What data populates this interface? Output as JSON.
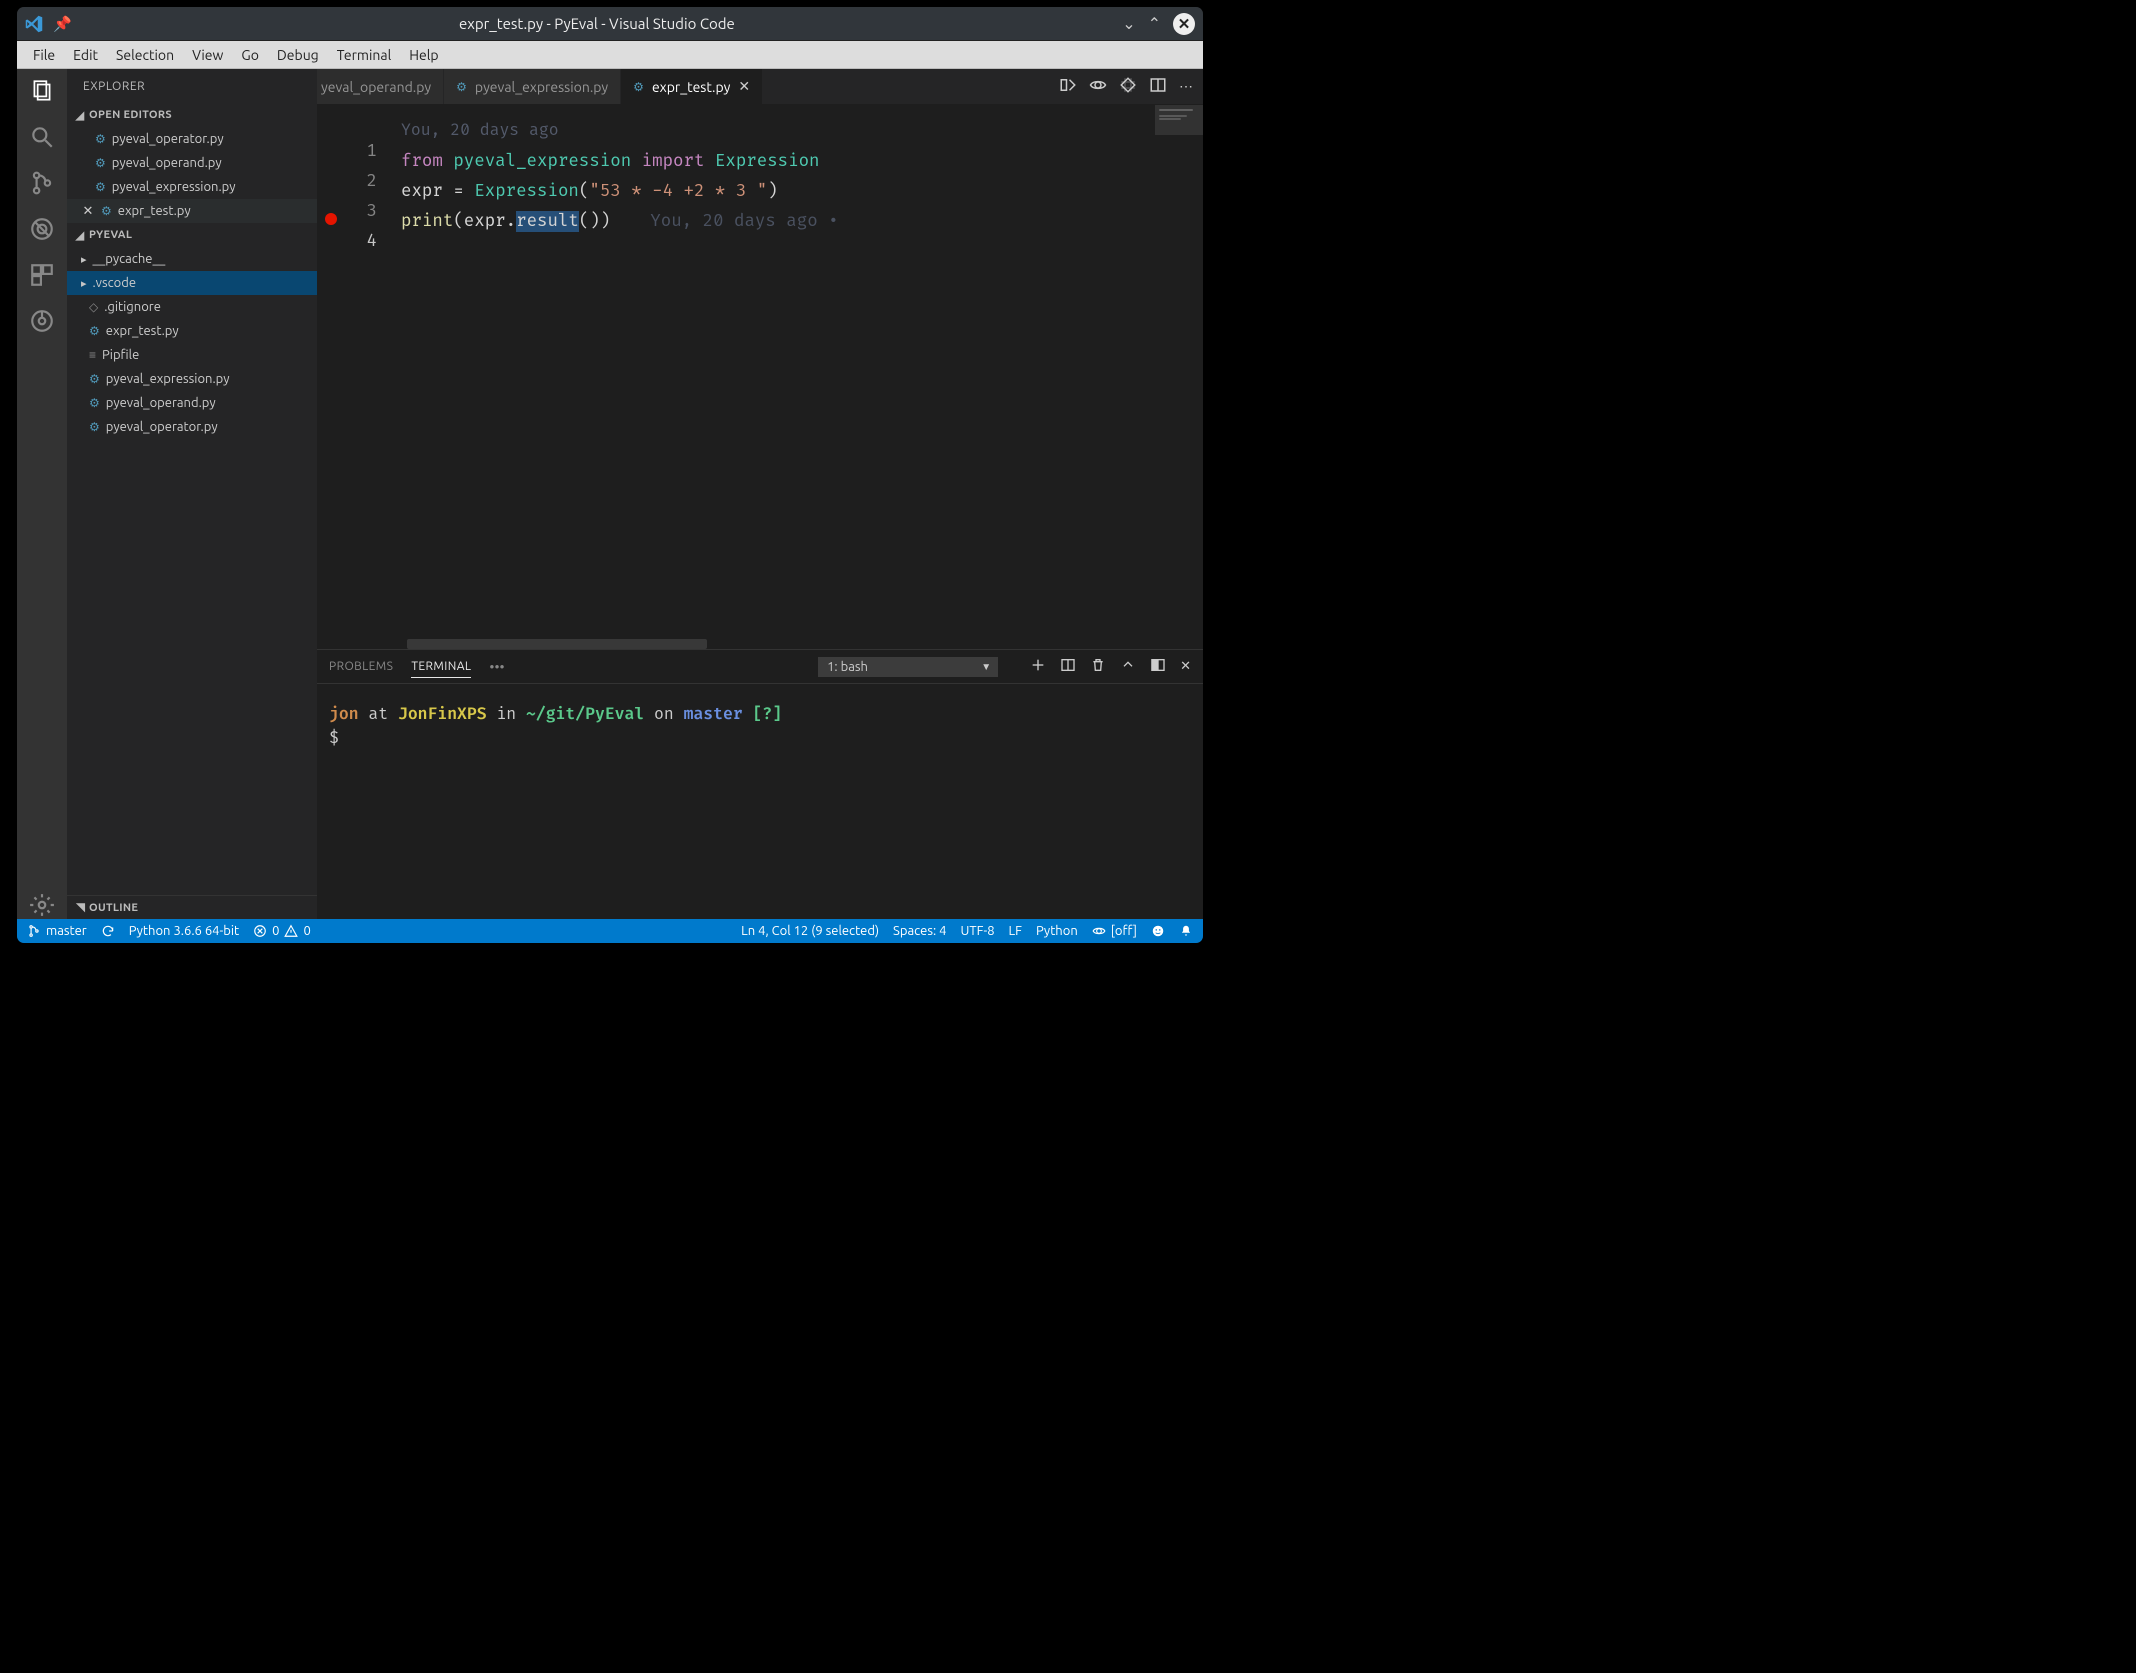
{
  "titlebar": {
    "title": "expr_test.py - PyEval - Visual Studio Code"
  },
  "menubar": [
    "File",
    "Edit",
    "Selection",
    "View",
    "Go",
    "Debug",
    "Terminal",
    "Help"
  ],
  "sidebar": {
    "title": "EXPLORER",
    "sections": {
      "openEditors": {
        "label": "OPEN EDITORS",
        "items": [
          {
            "label": "pyeval_operator.py",
            "icon": "py"
          },
          {
            "label": "pyeval_operand.py",
            "icon": "py"
          },
          {
            "label": "pyeval_expression.py",
            "icon": "py"
          },
          {
            "label": "expr_test.py",
            "icon": "py",
            "dirty": true
          }
        ]
      },
      "project": {
        "label": "PYEVAL",
        "items": [
          {
            "label": "__pycache__",
            "type": "folder"
          },
          {
            "label": ".vscode",
            "type": "folder",
            "selected": true
          },
          {
            "label": ".gitignore",
            "type": "file",
            "icon": "git"
          },
          {
            "label": "expr_test.py",
            "type": "file",
            "icon": "py"
          },
          {
            "label": "Pipfile",
            "type": "file",
            "icon": "text"
          },
          {
            "label": "pyeval_expression.py",
            "type": "file",
            "icon": "py"
          },
          {
            "label": "pyeval_operand.py",
            "type": "file",
            "icon": "py"
          },
          {
            "label": "pyeval_operator.py",
            "type": "file",
            "icon": "py"
          }
        ]
      },
      "outline": {
        "label": "OUTLINE"
      }
    }
  },
  "tabs": [
    {
      "label": "yeval_operand.py",
      "active": false,
      "truncated": true
    },
    {
      "label": "pyeval_expression.py",
      "active": false
    },
    {
      "label": "expr_test.py",
      "active": true
    }
  ],
  "editor": {
    "blameHeader": "You, 20 days ago",
    "lines": [
      {
        "n": 1,
        "tokens": [
          [
            "kw",
            "from"
          ],
          [
            "sp",
            " "
          ],
          [
            "mod",
            "pyeval_expression"
          ],
          [
            "sp",
            " "
          ],
          [
            "kw",
            "import"
          ],
          [
            "sp",
            " "
          ],
          [
            "cls",
            "Expression"
          ]
        ]
      },
      {
        "n": 2,
        "tokens": []
      },
      {
        "n": 3,
        "tokens": [
          [
            "id",
            "expr"
          ],
          [
            "sp",
            " "
          ],
          [
            "id",
            "="
          ],
          [
            "sp",
            " "
          ],
          [
            "cls",
            "Expression"
          ],
          [
            "id",
            "("
          ],
          [
            "str",
            "\"53 *  -4 +2 *  3  \""
          ],
          [
            "id",
            ")"
          ]
        ]
      },
      {
        "n": 4,
        "tokens": [
          [
            "fn",
            "print"
          ],
          [
            "id",
            "("
          ],
          [
            "id",
            "expr"
          ],
          [
            "id",
            "."
          ],
          [
            "sel",
            "result"
          ],
          [
            "id",
            "("
          ],
          [
            "id",
            ")"
          ],
          [
            "id",
            ")"
          ]
        ],
        "blame": "You, 20 days ago •",
        "breakpoint": true,
        "active": true
      }
    ]
  },
  "panel": {
    "tabs": [
      "PROBLEMS",
      "TERMINAL"
    ],
    "activeTab": "TERMINAL",
    "terminalName": "1: bash",
    "prompt": {
      "user": "jon",
      "at": "at",
      "host": "JonFinXPS",
      "in": "in",
      "path": "~/git/PyEval",
      "on": "on",
      "branch": "master",
      "flag": "[?]",
      "ps": "$"
    }
  },
  "statusbar": {
    "branch": "master",
    "python": "Python 3.6.6 64-bit",
    "errors": "0",
    "warnings": "0",
    "cursor": "Ln 4, Col 12 (9 selected)",
    "spaces": "Spaces: 4",
    "encoding": "UTF-8",
    "eol": "LF",
    "lang": "Python",
    "live": "[off]"
  }
}
